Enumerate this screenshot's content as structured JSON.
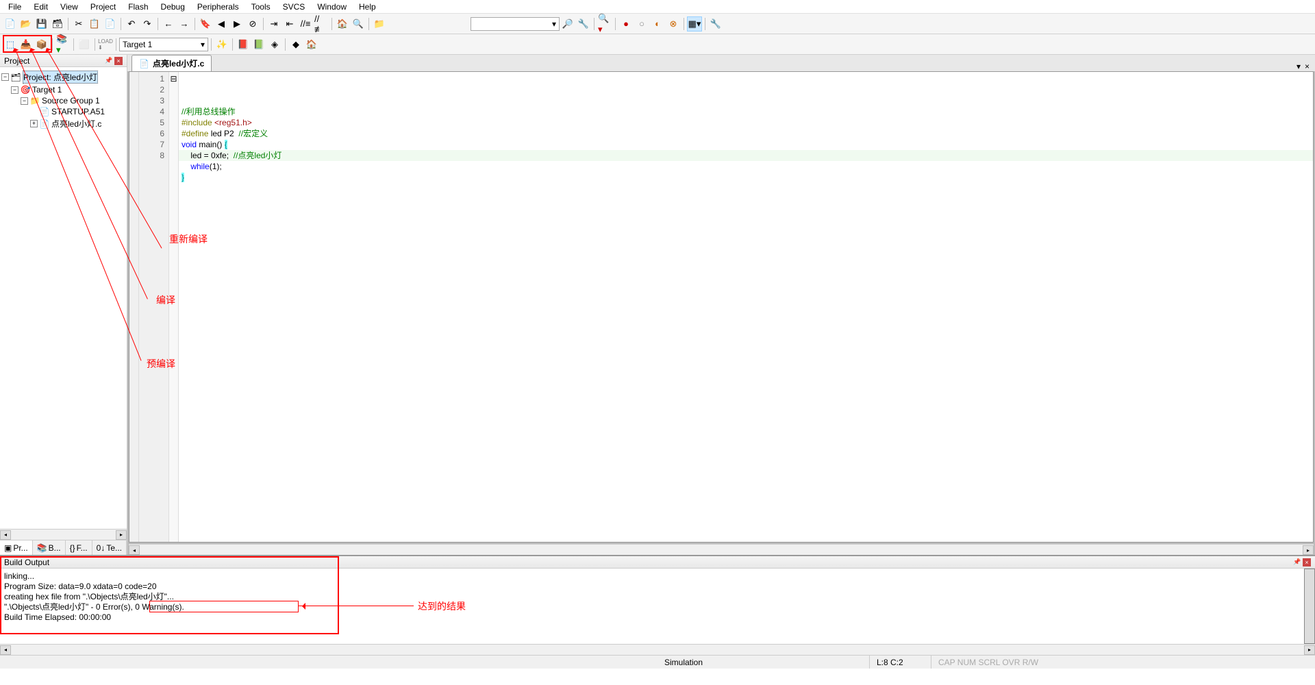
{
  "menu": [
    "File",
    "Edit",
    "View",
    "Project",
    "Flash",
    "Debug",
    "Peripherals",
    "Tools",
    "SVCS",
    "Window",
    "Help"
  ],
  "toolbar2_target": "Target 1",
  "project_panel_title": "Project",
  "tree": {
    "root": "Project: 点亮led小灯",
    "target": "Target 1",
    "group": "Source Group 1",
    "file1": "STARTUP.A51",
    "file2": "点亮led小灯.c"
  },
  "panel_tabs": [
    "Pr...",
    "B...",
    "{} F...",
    "0↓ Te..."
  ],
  "editor_tab": "点亮led小灯.c",
  "code_lines": [
    {
      "n": 1,
      "html": "<span class='c-comment'>//利用总线操作</span>"
    },
    {
      "n": 2,
      "html": "<span class='c-pre'>#include</span> <span class='c-str'>&lt;reg51.h&gt;</span>"
    },
    {
      "n": 3,
      "html": "<span class='c-pre'>#define</span> led P2  <span class='c-comment'>//宏定义</span>"
    },
    {
      "n": 4,
      "html": ""
    },
    {
      "n": 5,
      "html": "<span class='c-kw'>void</span> main() <span class='c-br'>{</span>"
    },
    {
      "n": 6,
      "html": "    led = <span class='c-num'>0xfe</span>;  <span class='c-comment'>//点亮led小灯</span>"
    },
    {
      "n": 7,
      "html": "    <span class='c-kw'>while</span>(<span class='c-num'>1</span>);"
    },
    {
      "n": 8,
      "html": "<span class='c-br'>}</span>"
    }
  ],
  "fold_marks": {
    "5": "⊟"
  },
  "build_title": "Build Output",
  "build_lines": [
    "linking...",
    "Program Size: data=9.0 xdata=0 code=20",
    "creating hex file from \".\\Objects\\点亮led小灯\"...",
    "\".\\Objects\\点亮led小灯\" - 0 Error(s), 0 Warning(s).",
    "Build Time Elapsed:  00:00:00"
  ],
  "annotations": {
    "a1": "重新编译",
    "a2": "编译",
    "a3": "预编译",
    "a4": "达到的结果"
  },
  "status": {
    "sim": "Simulation",
    "loc": "L:8 C:2",
    "caps": "CAP NUM SCRL OVR R/W"
  }
}
